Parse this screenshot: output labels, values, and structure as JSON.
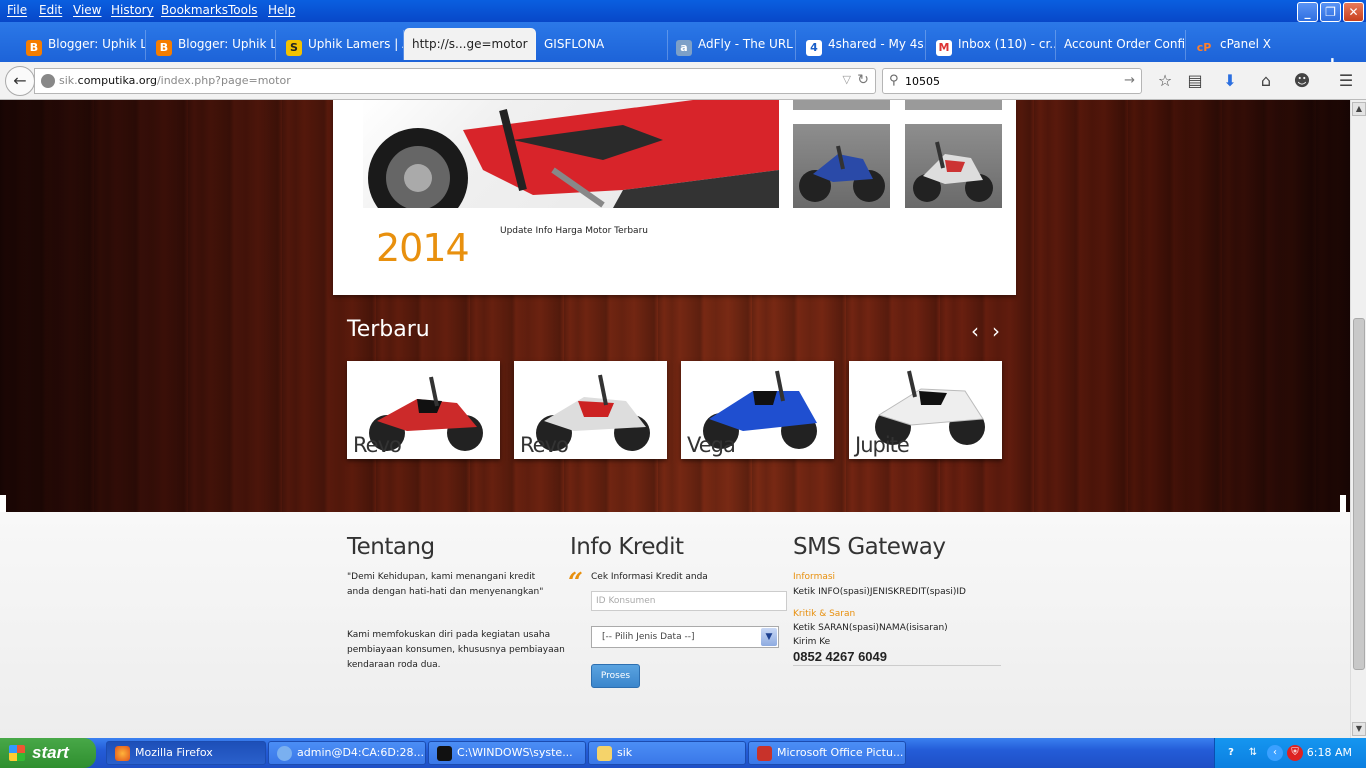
{
  "menu": [
    "File",
    "Edit",
    "View",
    "History",
    "Bookmarks",
    "Tools",
    "Help"
  ],
  "tabs": [
    {
      "label": "Blogger: Uphik L...",
      "icon": "blogger-icon"
    },
    {
      "label": "Blogger: Uphik L...",
      "icon": "blogger-icon"
    },
    {
      "label": "Uphik Lamers | A...",
      "icon": "s-logo-icon"
    },
    {
      "label": "http://s...ge=motor",
      "icon": "",
      "active": true
    },
    {
      "label": "GISFLONA",
      "icon": ""
    },
    {
      "label": "AdFly - The URL ...",
      "icon": "adfly-icon"
    },
    {
      "label": "4shared - My 4s...",
      "icon": "4shared-icon"
    },
    {
      "label": "Inbox (110) - cr...",
      "icon": "gmail-icon"
    },
    {
      "label": "Account Order Confir...",
      "icon": ""
    },
    {
      "label": "cPanel X",
      "icon": "cpanel-icon"
    }
  ],
  "nav": {
    "url_domain": "sik.",
    "url_host": "computika.org",
    "url_path": "/index.php?page=motor",
    "search_value": "10505"
  },
  "page": {
    "year": "2014",
    "update_text": "Update Info Harga Motor Terbaru",
    "terbaru_title": "Terbaru",
    "cards": [
      "Revo",
      "Revo",
      "Vega",
      "Jupite"
    ],
    "footer": {
      "tentang_title": "Tentang",
      "tentang_quote_1": "\"Demi Kehidupan, kami menangani kredit",
      "tentang_quote_2": "anda dengan hati-hati dan menyenangkan\"",
      "tentang_p1": "Kami memfokuskan diri pada kegiatan usaha",
      "tentang_p2": "pembiayaan konsumen, khususnya pembiayaan",
      "tentang_p3": "kendaraan roda dua.",
      "kredit_title": "Info Kredit",
      "kredit_cek": "Cek Informasi Kredit anda",
      "kredit_placeholder": "ID Konsumen",
      "kredit_select": "[-- Pilih Jenis Data --]",
      "kredit_button": "Proses",
      "sms_title": "SMS Gateway",
      "sms_info_label": "Informasi",
      "sms_info_text": "Ketik INFO(spasi)JENISKREDIT(spasi)ID",
      "sms_kritik_label": "Kritik & Saran",
      "sms_kritik_text": "Ketik SARAN(spasi)NAMA(isisaran)",
      "sms_kirim": "Kirim Ke",
      "sms_phone": "0852 4267 6049"
    }
  },
  "taskbar": {
    "start": "start",
    "tasks": [
      {
        "label": "Mozilla Firefox",
        "active": true
      },
      {
        "label": "admin@D4:CA:6D:28..."
      },
      {
        "label": "C:\\WINDOWS\\syste..."
      },
      {
        "label": "sik"
      },
      {
        "label": "Microsoft Office Pictu..."
      }
    ],
    "clock": "6:18 AM"
  },
  "colors": {
    "accent_orange": "#e8900e",
    "titlebar_blue": "#0a5fe0",
    "proses_blue": "#3b86cc"
  }
}
